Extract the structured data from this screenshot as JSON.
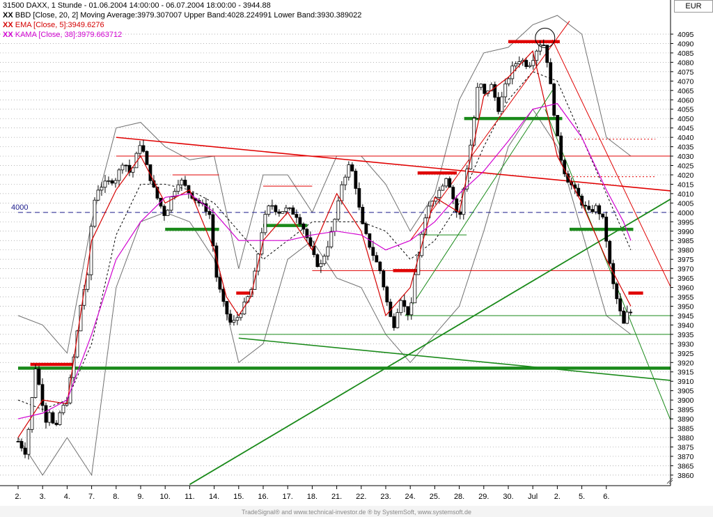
{
  "header": {
    "title": "31500  DAXX, 1 Stunde - 01.06.2004 14:00:00 - 06.07.2004 18:00:00 - 3944.88",
    "legend": [
      {
        "marker": "XX",
        "text": "BBD [Close, 20, 2] Moving Average:3979.307007 Upper Band:4028.224991 Lower Band:3930.389022",
        "color": "#000000"
      },
      {
        "marker": "XX",
        "text": "EMA [Close, 5]:3949.6276",
        "color": "#d40000"
      },
      {
        "marker": "XX",
        "text": "KAMA [Close, 38]:3979.663712",
        "color": "#d000d0"
      }
    ]
  },
  "currency": "EUR",
  "reference_label": "4000",
  "footer": "TradeSignal® and www.technical-investor.de ® by SystemSoft, www.systemsoft.de",
  "colors": {
    "candle": "#000000",
    "ema": "#d40000",
    "kama": "#d000d0",
    "bands": "#707070",
    "support": "#1a8a1a",
    "resistance": "#e00000",
    "grid": "#999999"
  },
  "chart_data": {
    "type": "candlestick",
    "title": "31500  DAXX, 1 Stunde",
    "y_ticks": [
      3860,
      3865,
      3870,
      3875,
      3880,
      3885,
      3890,
      3895,
      3900,
      3905,
      3910,
      3915,
      3920,
      3925,
      3930,
      3935,
      3940,
      3945,
      3950,
      3955,
      3960,
      3965,
      3970,
      3975,
      3980,
      3985,
      3990,
      3995,
      4000,
      4005,
      4010,
      4015,
      4020,
      4025,
      4030,
      4035,
      4040,
      4045,
      4050,
      4055,
      4060,
      4065,
      4070,
      4075,
      4080,
      4085,
      4090,
      4095
    ],
    "ylim": [
      3855,
      4099
    ],
    "x_labels": [
      "2.",
      "3.",
      "4.",
      "7.",
      "8.",
      "9.",
      "10.",
      "11.",
      "14.",
      "15.",
      "16.",
      "17.",
      "18.",
      "21.",
      "22.",
      "23.",
      "24.",
      "25.",
      "28.",
      "29.",
      "30.",
      "Jul",
      "2.",
      "5.",
      "6."
    ],
    "grid": "horizontal dotted",
    "close_path": [
      [
        0,
        3878
      ],
      [
        0.3,
        3872
      ],
      [
        0.5,
        3892
      ],
      [
        0.7,
        3918
      ],
      [
        0.9,
        3905
      ],
      [
        1.0,
        3898
      ],
      [
        1.1,
        3888
      ],
      [
        1.3,
        3895
      ],
      [
        1.5,
        3882
      ],
      [
        1.7,
        3893
      ],
      [
        2.0,
        3900
      ],
      [
        2.3,
        3925
      ],
      [
        2.6,
        3955
      ],
      [
        2.9,
        3968
      ],
      [
        3.0,
        3998
      ],
      [
        3.2,
        4012
      ],
      [
        3.5,
        4015
      ],
      [
        4.0,
        4018
      ],
      [
        4.3,
        4028
      ],
      [
        4.6,
        4020
      ],
      [
        5.0,
        4038
      ],
      [
        5.3,
        4022
      ],
      [
        5.6,
        4010
      ],
      [
        6.0,
        3998
      ],
      [
        6.3,
        4010
      ],
      [
        6.6,
        4018
      ],
      [
        7.0,
        4010
      ],
      [
        7.4,
        4005
      ],
      [
        7.8,
        4000
      ],
      [
        8.1,
        3965
      ],
      [
        8.4,
        3950
      ],
      [
        8.7,
        3940
      ],
      [
        9.0,
        3945
      ],
      [
        9.2,
        3950
      ],
      [
        9.5,
        3958
      ],
      [
        9.7,
        3970
      ],
      [
        10.0,
        3995
      ],
      [
        10.3,
        4005
      ],
      [
        10.6,
        4000
      ],
      [
        11.0,
        4002
      ],
      [
        11.4,
        3998
      ],
      [
        11.7,
        3990
      ],
      [
        12.0,
        3978
      ],
      [
        12.3,
        3970
      ],
      [
        12.7,
        3985
      ],
      [
        13.0,
        4000
      ],
      [
        13.2,
        4015
      ],
      [
        13.5,
        4025
      ],
      [
        13.7,
        4020
      ],
      [
        14.0,
        3995
      ],
      [
        14.4,
        3980
      ],
      [
        14.8,
        3968
      ],
      [
        15.0,
        3955
      ],
      [
        15.3,
        3938
      ],
      [
        15.6,
        3955
      ],
      [
        15.8,
        3948
      ],
      [
        16.0,
        3945
      ],
      [
        16.2,
        3968
      ],
      [
        16.5,
        3990
      ],
      [
        16.8,
        4005
      ],
      [
        17.2,
        4012
      ],
      [
        17.5,
        4020
      ],
      [
        17.8,
        4005
      ],
      [
        18.0,
        3995
      ],
      [
        18.2,
        4015
      ],
      [
        18.4,
        4030
      ],
      [
        18.6,
        4050
      ],
      [
        18.8,
        4072
      ],
      [
        19.0,
        4062
      ],
      [
        19.3,
        4068
      ],
      [
        19.6,
        4055
      ],
      [
        19.9,
        4068
      ],
      [
        20.2,
        4078
      ],
      [
        20.5,
        4082
      ],
      [
        20.8,
        4078
      ],
      [
        21.0,
        4082
      ],
      [
        21.2,
        4088
      ],
      [
        21.4,
        4092
      ],
      [
        21.6,
        4080
      ],
      [
        21.8,
        4060
      ],
      [
        22.0,
        4040
      ],
      [
        22.2,
        4025
      ],
      [
        22.4,
        4018
      ],
      [
        22.7,
        4012
      ],
      [
        23.0,
        4005
      ],
      [
        23.3,
        4000
      ],
      [
        23.6,
        4003
      ],
      [
        23.9,
        3995
      ],
      [
        24.1,
        3975
      ],
      [
        24.3,
        3960
      ],
      [
        24.5,
        3950
      ],
      [
        24.7,
        3940
      ],
      [
        24.9,
        3948
      ],
      [
        25.1,
        3944.88
      ]
    ],
    "ema_path": [
      [
        0,
        3880
      ],
      [
        1,
        3900
      ],
      [
        2,
        3898
      ],
      [
        3,
        3985
      ],
      [
        4,
        4012
      ],
      [
        5,
        4030
      ],
      [
        6,
        4005
      ],
      [
        7,
        4012
      ],
      [
        8,
        3980
      ],
      [
        8.5,
        3955
      ],
      [
        9,
        3945
      ],
      [
        9.5,
        3955
      ],
      [
        10,
        3985
      ],
      [
        11,
        4000
      ],
      [
        12,
        3980
      ],
      [
        13,
        4010
      ],
      [
        14,
        3990
      ],
      [
        15,
        3945
      ],
      [
        16,
        3960
      ],
      [
        17,
        4008
      ],
      [
        18,
        4000
      ],
      [
        19,
        4062
      ],
      [
        20,
        4072
      ],
      [
        21,
        4086
      ],
      [
        22,
        4030
      ],
      [
        23,
        4005
      ],
      [
        24,
        3975
      ],
      [
        25,
        3950
      ]
    ],
    "kama_path": [
      [
        0,
        3890
      ],
      [
        1,
        3893
      ],
      [
        2,
        3900
      ],
      [
        3,
        3935
      ],
      [
        4,
        3975
      ],
      [
        5,
        3995
      ],
      [
        6,
        4008
      ],
      [
        7,
        4010
      ],
      [
        8,
        4000
      ],
      [
        9,
        3985
      ],
      [
        10,
        3985
      ],
      [
        11,
        3985
      ],
      [
        12,
        3988
      ],
      [
        13,
        3990
      ],
      [
        14,
        3988
      ],
      [
        15,
        3980
      ],
      [
        16,
        3985
      ],
      [
        17,
        3995
      ],
      [
        18,
        4010
      ],
      [
        19,
        4022
      ],
      [
        20,
        4038
      ],
      [
        21,
        4055
      ],
      [
        22,
        4058
      ],
      [
        23,
        4040
      ],
      [
        24,
        4012
      ],
      [
        24.7,
        3995
      ],
      [
        25,
        3985
      ]
    ],
    "bollinger_mid_path": [
      [
        0,
        3900
      ],
      [
        1,
        3895
      ],
      [
        2,
        3900
      ],
      [
        3,
        3930
      ],
      [
        4,
        3988
      ],
      [
        5,
        4015
      ],
      [
        6,
        4015
      ],
      [
        7,
        4012
      ],
      [
        8,
        4005
      ],
      [
        9,
        3990
      ],
      [
        10,
        3975
      ],
      [
        11,
        3985
      ],
      [
        12,
        3995
      ],
      [
        13,
        3995
      ],
      [
        14,
        3995
      ],
      [
        15,
        3990
      ],
      [
        16,
        3975
      ],
      [
        17,
        3985
      ],
      [
        18,
        4005
      ],
      [
        19,
        4035
      ],
      [
        20,
        4060
      ],
      [
        21,
        4075
      ],
      [
        22,
        4070
      ],
      [
        23,
        4040
      ],
      [
        24,
        4010
      ],
      [
        25,
        3980
      ]
    ],
    "bollinger_upper_path": [
      [
        0,
        3945
      ],
      [
        1,
        3940
      ],
      [
        2,
        3925
      ],
      [
        3,
        3995
      ],
      [
        4,
        4045
      ],
      [
        5,
        4048
      ],
      [
        6,
        4035
      ],
      [
        7,
        4028
      ],
      [
        8,
        4030
      ],
      [
        9,
        3970
      ],
      [
        10,
        4020
      ],
      [
        11,
        4020
      ],
      [
        12,
        4000
      ],
      [
        13,
        4030
      ],
      [
        14,
        4030
      ],
      [
        15,
        4015
      ],
      [
        16,
        3990
      ],
      [
        17,
        4010
      ],
      [
        18,
        4060
      ],
      [
        19,
        4085
      ],
      [
        20,
        4088
      ],
      [
        21,
        4100
      ],
      [
        22,
        4105
      ],
      [
        23,
        4095
      ],
      [
        24,
        4040
      ],
      [
        25,
        4030
      ]
    ],
    "bollinger_lower_path": [
      [
        0,
        3880
      ],
      [
        1,
        3860
      ],
      [
        2,
        3880
      ],
      [
        3,
        3860
      ],
      [
        4,
        3960
      ],
      [
        5,
        3995
      ],
      [
        6,
        4000
      ],
      [
        7,
        3995
      ],
      [
        8,
        3975
      ],
      [
        9,
        3920
      ],
      [
        10,
        3930
      ],
      [
        11,
        3975
      ],
      [
        12,
        3985
      ],
      [
        13,
        3965
      ],
      [
        14,
        3960
      ],
      [
        15,
        3935
      ],
      [
        16,
        3920
      ],
      [
        17,
        3935
      ],
      [
        18,
        3950
      ],
      [
        19,
        3990
      ],
      [
        20,
        4035
      ],
      [
        21,
        4055
      ],
      [
        22,
        4035
      ],
      [
        23,
        3990
      ],
      [
        24,
        3945
      ],
      [
        25,
        3935
      ]
    ],
    "horizontal_lines": [
      {
        "value": 4000,
        "style": "dashed",
        "color": "#1a1a8a",
        "from": 0,
        "to": 27
      },
      {
        "value": 3917,
        "style": "thick",
        "color": "#1a8a1a",
        "from": 0,
        "to": 27
      },
      {
        "value": 3919,
        "style": "thick",
        "color": "#e00000",
        "from": 0.5,
        "to": 2.3
      },
      {
        "value": 3991,
        "style": "thick",
        "color": "#1a8a1a",
        "from": 6,
        "to": 8.2
      },
      {
        "value": 3957,
        "style": "thick",
        "color": "#e00000",
        "from": 8.9,
        "to": 9.6
      },
      {
        "value": 3993,
        "style": "thick",
        "color": "#1a8a1a",
        "from": 10,
        "to": 11.8
      },
      {
        "value": 3969,
        "style": "thick",
        "color": "#e00000",
        "from": 15.3,
        "to": 16.4
      },
      {
        "value": 4021,
        "style": "thick",
        "color": "#e00000",
        "from": 16.3,
        "to": 17.9
      },
      {
        "value": 4050,
        "style": "thick",
        "color": "#1a8a1a",
        "from": 18.2,
        "to": 22.2
      },
      {
        "value": 4091,
        "style": "thick",
        "color": "#e00000",
        "from": 20,
        "to": 22.1
      },
      {
        "value": 3991,
        "style": "thick",
        "color": "#1a8a1a",
        "from": 22.5,
        "to": 25.1
      },
      {
        "value": 3957,
        "style": "thick",
        "color": "#e00000",
        "from": 24.9,
        "to": 25.5
      },
      {
        "value": 4030,
        "style": "thin",
        "color": "#e00000",
        "from": 4,
        "to": 27
      },
      {
        "value": 3969,
        "style": "thin",
        "color": "#e00000",
        "from": 12,
        "to": 27
      },
      {
        "value": 3945,
        "style": "thin",
        "color": "#1a8a1a",
        "from": 15.8,
        "to": 27
      },
      {
        "value": 3935,
        "style": "thin",
        "color": "#1a8a1a",
        "from": 9,
        "to": 27
      },
      {
        "value": 3988,
        "style": "thin",
        "color": "#1a8a1a",
        "from": 16.3,
        "to": 18.3
      },
      {
        "value": 4020,
        "style": "thin",
        "color": "#e00000",
        "from": 6.3,
        "to": 8.2
      },
      {
        "value": 4014,
        "style": "thin",
        "color": "#e00000",
        "from": 10,
        "to": 12
      },
      {
        "value": 4039,
        "style": "dotted",
        "color": "#e00000",
        "from": 22.7,
        "to": 26
      },
      {
        "value": 4019,
        "style": "dotted",
        "color": "#e00000",
        "from": 22.5,
        "to": 26
      }
    ],
    "trend_lines": [
      {
        "from": [
          4,
          4040
        ],
        "to": [
          27,
          4011
        ],
        "color": "#e00000",
        "width": 1.6
      },
      {
        "from": [
          9,
          3933
        ],
        "to": [
          27,
          3910
        ],
        "color": "#1a8a1a",
        "width": 1.6
      },
      {
        "from": [
          7,
          3855
        ],
        "to": [
          27,
          4010
        ],
        "color": "#1a8a1a",
        "width": 1.8
      },
      {
        "from": [
          15.8,
          3945
        ],
        "to": [
          21.8,
          4065
        ],
        "color": "#1a8a1a",
        "width": 1
      },
      {
        "from": [
          16,
          3985
        ],
        "to": [
          22.5,
          4102
        ],
        "color": "#e00000",
        "width": 1
      },
      {
        "from": [
          21.5,
          4055
        ],
        "to": [
          27,
          3877
        ],
        "color": "#1a8a1a",
        "width": 1
      },
      {
        "from": [
          21.8,
          4092
        ],
        "to": [
          27,
          3950
        ],
        "color": "#e00000",
        "width": 1
      }
    ],
    "circle_marker": {
      "x": 21.5,
      "y": 4093
    }
  }
}
